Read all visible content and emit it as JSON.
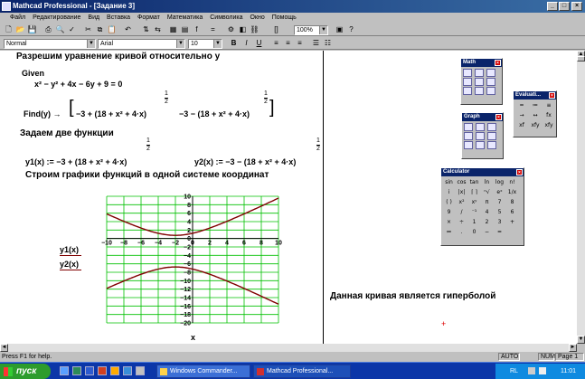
{
  "window": {
    "title": "Mathcad Professional - [Задание 3]"
  },
  "menu": [
    "Файл",
    "Редактирование",
    "Вид",
    "Вставка",
    "Формат",
    "Математика",
    "Символика",
    "Окно",
    "Помощь"
  ],
  "format_bar": {
    "style": "Normal",
    "font": "Arial",
    "size": "10",
    "bold": "B",
    "italic": "I",
    "underline": "U"
  },
  "toolbar": {
    "zoom": "100%"
  },
  "doc": {
    "heading": "Разрешим уравнение кривой относительно у",
    "given": "Given",
    "equation": "x² − y² + 4x − 6y + 9 = 0",
    "find_expr": "Find(y) → [ −3 + (18 + x² + 4·x)^(1/2)   −3 − (18 + x² + 4·x)^(1/2) ]",
    "find_label": "Find(y) →",
    "root1_prefix": "−3 + (18 + x² + 4·x)",
    "root2_prefix": "−3 − (18 + x² + 4·x)",
    "half_num": "1",
    "half_den": "2",
    "define_heading": "Задаем две функции",
    "y1_def": "y1(x) := −3 + (18 + x² + 4·x)",
    "y2_def": "y2(x) := −3 − (18 + x² + 4·x)",
    "plot_heading": "Строим графики функций в одной системе координат",
    "legend1": "y1(x)",
    "legend2": "y2(x)",
    "xlabel": "x",
    "conclusion": "Данная кривая является гиперболой"
  },
  "chart_data": {
    "type": "line",
    "x_range": [
      -10,
      10
    ],
    "ylim": [
      -20,
      10
    ],
    "grid": true,
    "x_ticks": [
      "−10",
      "−8",
      "−6",
      "−4",
      "−2",
      "0",
      "2",
      "4",
      "6",
      "8",
      "10"
    ],
    "y_ticks": [
      "10",
      "8",
      "6",
      "4",
      "2",
      "0",
      "−2",
      "−4",
      "−6",
      "−8",
      "−10",
      "−12",
      "−14",
      "−16",
      "−18",
      "−20"
    ],
    "series": [
      {
        "name": "y1(x)",
        "formula": "-3 + sqrt(18 + x^2 + 4x)",
        "color": "#800000"
      },
      {
        "name": "y2(x)",
        "formula": "-3 - sqrt(18 + x^2 + 4x)",
        "color": "#800000"
      }
    ],
    "xlabel": "x"
  },
  "palettes": {
    "math": {
      "title": "Math"
    },
    "evaluation": {
      "title": "Evaluati...",
      "items": [
        "=",
        "≔",
        "≡",
        "→",
        "↔",
        "fx",
        "xf",
        "xfy",
        "xfy"
      ]
    },
    "graph": {
      "title": "Graph"
    },
    "calculator": {
      "title": "Calculator",
      "items": [
        "sin",
        "cos",
        "tan",
        "ln",
        "log",
        "n!",
        "i",
        "|x|",
        "⌈ ⌉",
        "ⁿ√",
        "eˣ",
        "1/x",
        "( )",
        "x²",
        "xʸ",
        "π",
        "7",
        "8",
        "9",
        "/",
        "⁻¹",
        "4",
        "5",
        "6",
        "×",
        "÷",
        "1",
        "2",
        "3",
        "+",
        "≔",
        ".",
        "0",
        "−",
        "="
      ]
    }
  },
  "status": {
    "help": "Press F1 for help.",
    "mode": "AUTO",
    "num": "NUM",
    "page": "Page 1"
  },
  "taskbar": {
    "start": "пуск",
    "tasks": [
      "Windows Commander...",
      "Mathcad Professional..."
    ],
    "lang": "RL",
    "clock": "11:01"
  }
}
